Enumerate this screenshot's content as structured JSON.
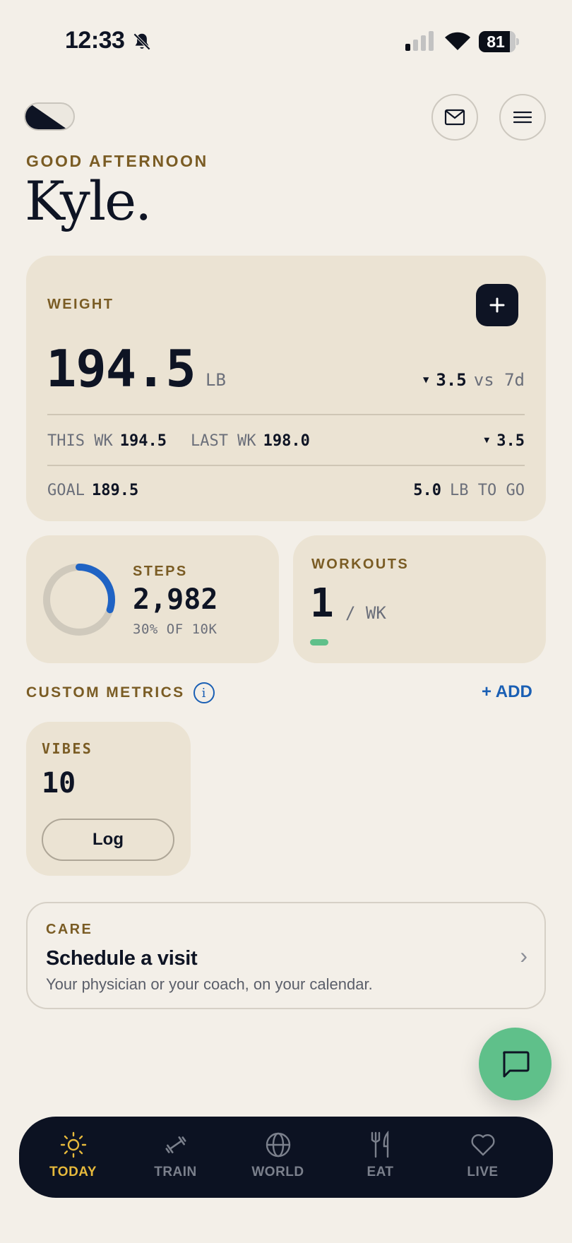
{
  "status_bar": {
    "time": "12:33",
    "battery": "81",
    "icons": [
      "bell-slash-icon",
      "signal-icon",
      "wifi-icon",
      "battery-icon"
    ]
  },
  "header": {
    "greeting": "GOOD AFTERNOON",
    "name": "Kyle.",
    "icons": [
      "theme-toggle-icon",
      "mail-icon",
      "menu-icon"
    ]
  },
  "weight": {
    "label": "WEIGHT",
    "value": "194.5",
    "unit": "LB",
    "delta_value": "3.5",
    "delta_suffix": "vs 7d",
    "this_wk_label": "THIS WK",
    "this_wk_value": "194.5",
    "last_wk_label": "LAST WK",
    "last_wk_value": "198.0",
    "week_delta": "3.5",
    "goal_label": "GOAL",
    "goal_value": "189.5",
    "to_go_value": "5.0",
    "to_go_label": "LB TO GO"
  },
  "steps": {
    "label": "STEPS",
    "value": "2,982",
    "sub": "30% OF 10K",
    "progress": 0.3
  },
  "workouts": {
    "label": "WORKOUTS",
    "value": "1",
    "unit": "/ WK"
  },
  "custom_metrics": {
    "title": "CUSTOM METRICS",
    "info": "i",
    "add_label": "+ ADD",
    "items": [
      {
        "label": "VIBES",
        "value": "10",
        "button": "Log"
      }
    ]
  },
  "care": {
    "label": "CARE",
    "title": "Schedule a visit",
    "subtitle": "Your physician or your coach, on your calendar.",
    "chevron": "›"
  },
  "tabs": [
    {
      "label": "TODAY",
      "icon": "sun-icon",
      "active": true
    },
    {
      "label": "TRAIN",
      "icon": "dumbbell-icon",
      "active": false
    },
    {
      "label": "WORLD",
      "icon": "globe-icon",
      "active": false
    },
    {
      "label": "EAT",
      "icon": "utensils-icon",
      "active": false
    },
    {
      "label": "LIVE",
      "icon": "heart-icon",
      "active": false
    }
  ],
  "colors": {
    "background": "#f3efe8",
    "card": "#ebe3d3",
    "gold": "#7a5c24",
    "accent_blue": "#1a5fb4",
    "green": "#5fc08a",
    "navy": "#0e1424",
    "active_tab": "#e6b93c"
  }
}
